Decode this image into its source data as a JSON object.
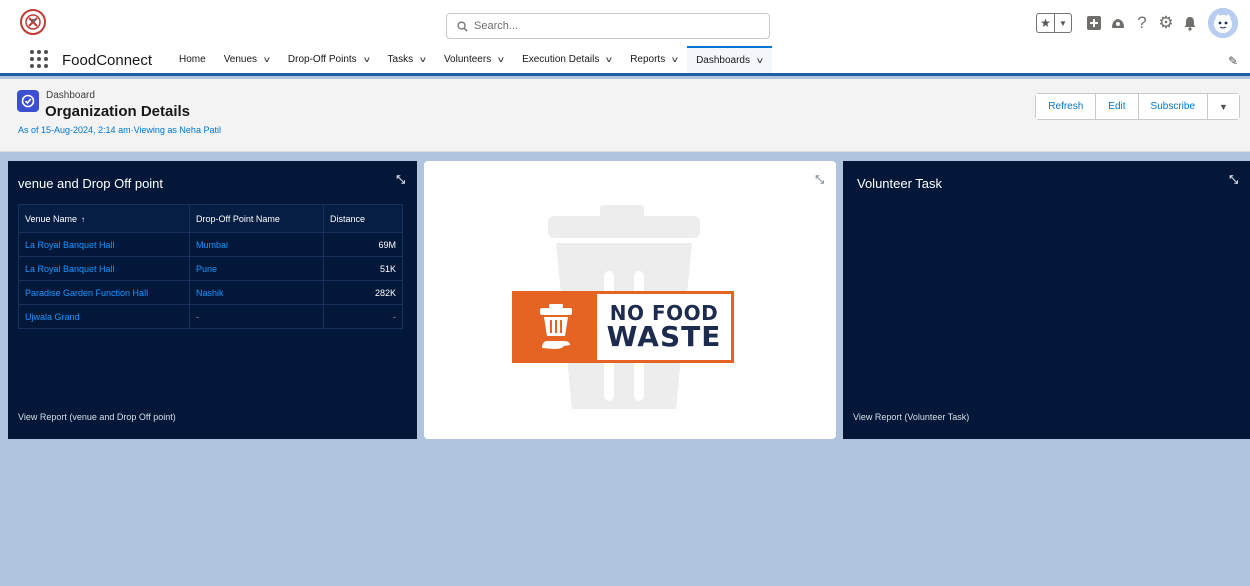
{
  "header": {
    "search_placeholder": "Search...",
    "icons": [
      "favorites-star-icon",
      "favorites-dropdown-icon",
      "global-add-icon",
      "trailhead-icon",
      "help-icon",
      "setup-gear-icon",
      "notifications-bell-icon",
      "user-avatar"
    ]
  },
  "nav": {
    "app_name": "FoodConnect",
    "items": [
      {
        "label": "Home",
        "has_menu": false
      },
      {
        "label": "Venues",
        "has_menu": true
      },
      {
        "label": "Drop-Off Points",
        "has_menu": true
      },
      {
        "label": "Tasks",
        "has_menu": true
      },
      {
        "label": "Volunteers",
        "has_menu": true
      },
      {
        "label": "Execution Details",
        "has_menu": true
      },
      {
        "label": "Reports",
        "has_menu": true
      },
      {
        "label": "Dashboards",
        "has_menu": true,
        "active": true
      }
    ]
  },
  "dashboard": {
    "kicker": "Dashboard",
    "title": "Organization Details",
    "subtitle": "As of 15-Aug-2024, 2:14 am·Viewing as Neha Patil",
    "buttons": {
      "refresh": "Refresh",
      "edit": "Edit",
      "subscribe": "Subscribe"
    }
  },
  "widgets": {
    "venue": {
      "title": "venue and Drop Off point",
      "columns": [
        "Venue Name",
        "Drop-Off Point Name",
        "Distance"
      ],
      "sort_indicator": "↑",
      "rows": [
        {
          "venue": "La Royal Banquet Hall",
          "dropoff": "Mumbai",
          "distance": "69M"
        },
        {
          "venue": "La Royal Banquet Hall",
          "dropoff": "Pune",
          "distance": "51K"
        },
        {
          "venue": "Paradise Garden Function Hall",
          "dropoff": "Nashik",
          "distance": "282K"
        },
        {
          "venue": "Ujwala Grand",
          "dropoff": "-",
          "distance": "-"
        }
      ],
      "footer": "View Report (venue and Drop Off point)"
    },
    "image": {
      "line1": "NO FOOD",
      "line2": "WASTE"
    },
    "volunteer": {
      "title": "Volunteer Task",
      "footer": "View Report (Volunteer Task)"
    }
  },
  "colors": {
    "brand_blue": "#0176d3",
    "widget_dark": "#031839",
    "canvas": "#b0c4de",
    "accent_orange": "#e56424",
    "navy_text": "#1d2b4f"
  }
}
